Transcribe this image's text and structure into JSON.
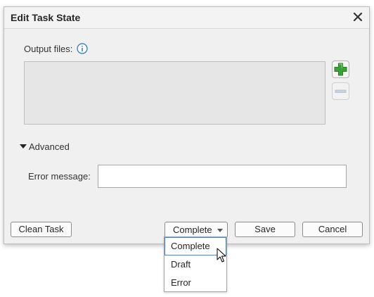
{
  "dialog": {
    "title": "Edit Task State"
  },
  "output": {
    "label": "Output files:",
    "items": []
  },
  "advanced": {
    "toggle_label": "Advanced",
    "expanded": true
  },
  "error": {
    "label": "Error message:",
    "value": ""
  },
  "buttons": {
    "clean_task": "Clean Task",
    "save": "Save",
    "cancel": "Cancel"
  },
  "state_select": {
    "value": "Complete",
    "options": [
      "Complete",
      "Draft",
      "Error"
    ],
    "highlighted_option": "Complete"
  },
  "icons": {
    "close": "close-icon",
    "info": "info-icon",
    "add": "plus-icon",
    "remove": "minus-icon",
    "cursor": "mouse-pointer-icon"
  },
  "colors": {
    "add_green": "#3aa335",
    "info_blue": "#1f73c9",
    "selection_border": "#3d8bd4",
    "dialog_bg": "#f0f0f0"
  }
}
